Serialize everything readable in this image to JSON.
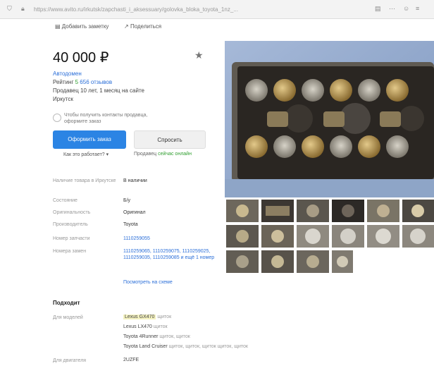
{
  "browser": {
    "url": "https://www.avito.ru/irkutsk/zapchasti_i_aksessuary/golovka_bloka_toyota_1nz_...",
    "icons": [
      "shield-icon",
      "lock-icon",
      "reader-icon",
      "menu-icon"
    ]
  },
  "actions": {
    "favorite": "Добавить заметку",
    "share": "Поделиться"
  },
  "listing": {
    "price": "40 000 ₽",
    "seller": "Автодомен",
    "rating_prefix": "Рейтинг",
    "rating_value": "5",
    "reviews": "656 отзывов",
    "since": "Продавец 10 лет, 1 месяц на сайте",
    "city": "Иркутск",
    "contact_note": "Чтобы получить контакты продавца, оформите заказ",
    "order_button": "Оформить заказ",
    "buy_button": "Спросить",
    "how_works": "Как это работает?",
    "seller_note_prefix": "Продавец",
    "seller_note_link": "сейчас онлайн"
  },
  "properties": [
    {
      "key": "Наличие товара в Иркутске",
      "value": "В наличии",
      "blue": false
    },
    {
      "key": "Состояние",
      "value": "Б/у",
      "blue": false
    },
    {
      "key": "Оригинальность",
      "value": "Оригинал",
      "blue": false
    },
    {
      "key": "Производитель",
      "value": "Toyota",
      "blue": false
    },
    {
      "key": "Номер запчасти",
      "value": "1110259055",
      "blue": true
    },
    {
      "key": "Номера замен",
      "value": "1110259065, 1110259075, 1110259025, 1110259035, 1110259085 и ещё 1 номер",
      "blue": true
    }
  ],
  "show_scheme": "Посмотреть на схеме",
  "fits": {
    "title": "Подходит",
    "key_models": "Для моделей",
    "key_engines": "Для двигателя",
    "models": [
      {
        "name": "Lexus GX470",
        "note": "щиток",
        "hl": true
      },
      {
        "name": "Lexus LX470",
        "note": "щиток",
        "hl": false
      },
      {
        "name": "Toyota 4Runner",
        "note": "щиток, щиток",
        "hl": false
      },
      {
        "name": "Toyota Land Cruiser",
        "note": "щиток, щиток, щиток щиток, щиток",
        "hl": false
      }
    ],
    "engine": "2UZFE"
  },
  "colors": {
    "accent": "#2b84e4",
    "link": "#2a6ed8",
    "online": "#2f9e2f"
  }
}
